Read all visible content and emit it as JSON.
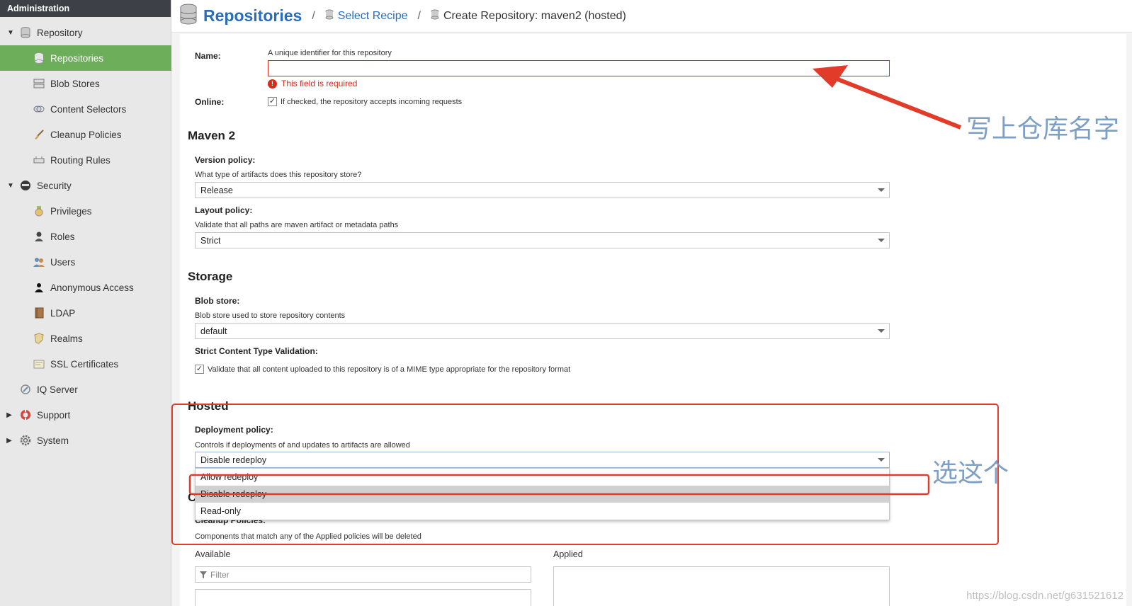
{
  "sidebar": {
    "header": "Administration",
    "items": [
      {
        "label": "Repository"
      },
      {
        "label": "Repositories"
      },
      {
        "label": "Blob Stores"
      },
      {
        "label": "Content Selectors"
      },
      {
        "label": "Cleanup Policies"
      },
      {
        "label": "Routing Rules"
      },
      {
        "label": "Security"
      },
      {
        "label": "Privileges"
      },
      {
        "label": "Roles"
      },
      {
        "label": "Users"
      },
      {
        "label": "Anonymous Access"
      },
      {
        "label": "LDAP"
      },
      {
        "label": "Realms"
      },
      {
        "label": "SSL Certificates"
      },
      {
        "label": "IQ Server"
      },
      {
        "label": "Support"
      },
      {
        "label": "System"
      }
    ]
  },
  "header": {
    "title": "Repositories",
    "sep": "/",
    "select_recipe": "Select Recipe",
    "crumb": "Create Repository: maven2 (hosted)"
  },
  "form": {
    "name_label": "Name:",
    "name_help": "A unique identifier for this repository",
    "name_value": "",
    "name_error": "This field is required",
    "online_label": "Online:",
    "online_checked": true,
    "online_text": "If checked, the repository accepts incoming requests",
    "maven_section": "Maven 2",
    "version_label": "Version policy:",
    "version_help": "What type of artifacts does this repository store?",
    "version_value": "Release",
    "layout_label": "Layout policy:",
    "layout_help": "Validate that all paths are maven artifact or metadata paths",
    "layout_value": "Strict",
    "storage_section": "Storage",
    "blob_label": "Blob store:",
    "blob_help": "Blob store used to store repository contents",
    "blob_value": "default",
    "strict_label": "Strict Content Type Validation:",
    "strict_checked": true,
    "strict_text": "Validate that all content uploaded to this repository is of a MIME type appropriate for the repository format",
    "hosted_section": "Hosted",
    "deploy_label": "Deployment policy:",
    "deploy_help": "Controls if deployments of and updates to artifacts are allowed",
    "deploy_value": "Disable redeploy",
    "deploy_options": [
      "Allow redeploy",
      "Disable redeploy",
      "Read-only"
    ],
    "cleanup_section_letter": "C",
    "cleanup_label": "Cleanup Policies:",
    "cleanup_help": "Components that match any of the Applied policies will be deleted",
    "available_label": "Available",
    "applied_label": "Applied",
    "filter_placeholder": "Filter"
  },
  "annotations": {
    "name_note": "写上仓库名字",
    "choose_note": "选这个",
    "color": "#e23b2a"
  },
  "watermark": "https://blog.csdn.net/g631521612"
}
